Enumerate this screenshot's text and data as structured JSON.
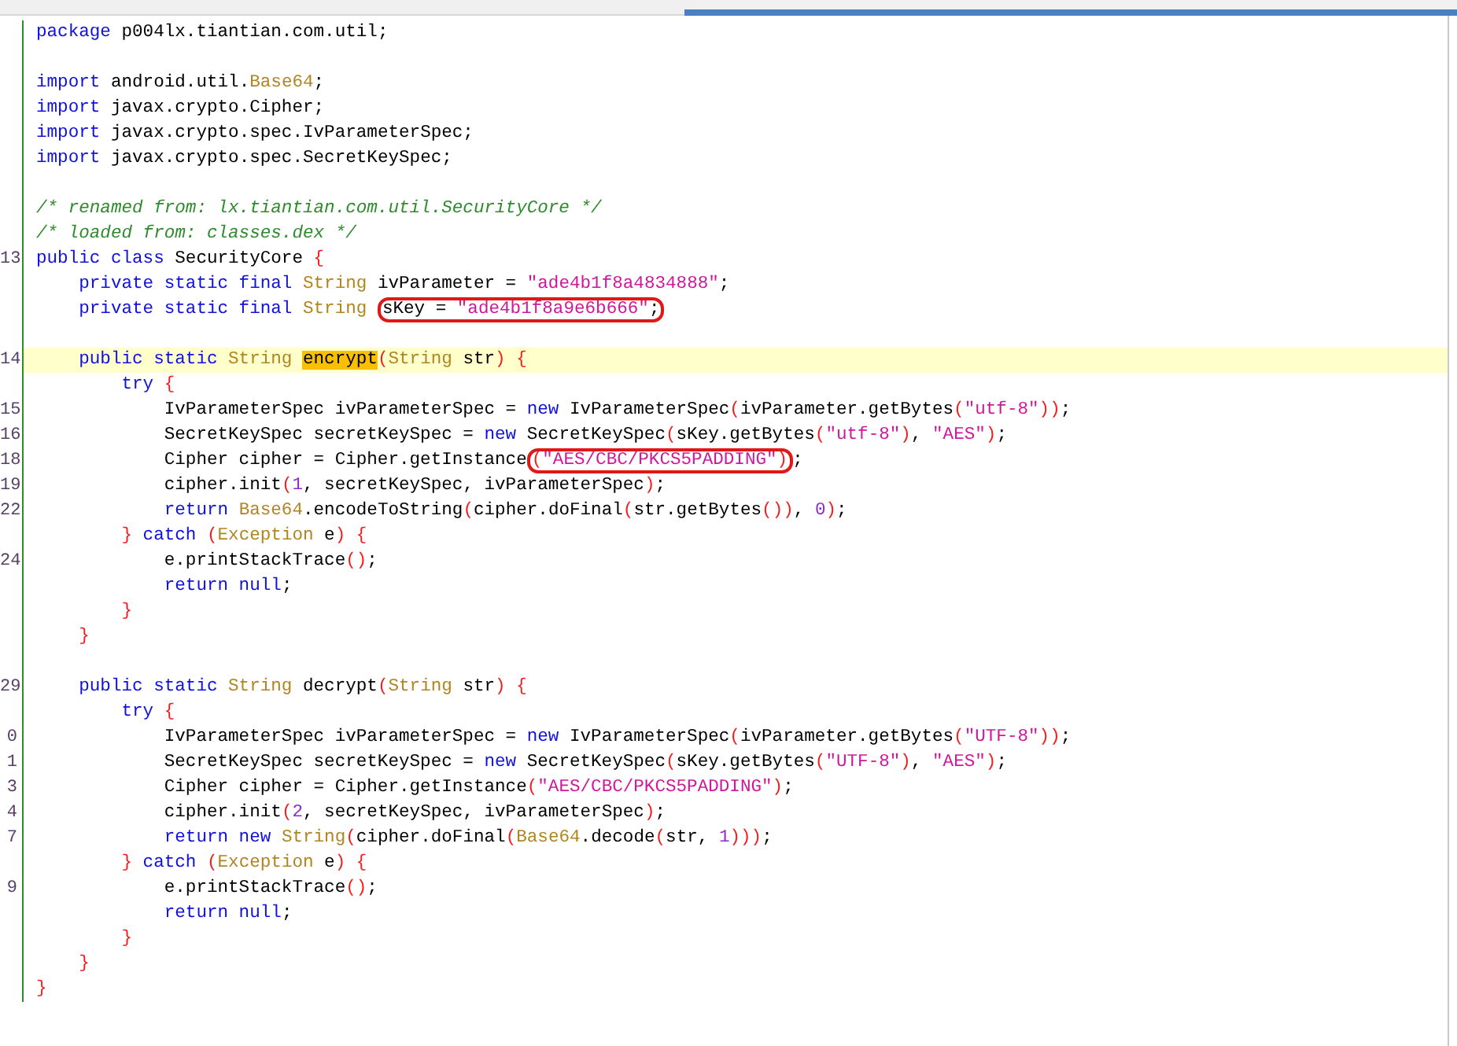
{
  "editor": {
    "lines": [
      {
        "current": false,
        "tokens": [
          {
            "kind": "keyword",
            "text": "package"
          },
          {
            "kind": "plain",
            "text": " p004lx.tiantian.com.util;"
          }
        ]
      },
      {
        "current": false
      },
      {
        "current": false,
        "tokens": [
          {
            "kind": "keyword",
            "text": "import"
          },
          {
            "kind": "plain",
            "text": " android.util."
          },
          {
            "kind": "type",
            "text": "Base64"
          },
          {
            "kind": "plain",
            "text": ";"
          }
        ]
      },
      {
        "current": false,
        "tokens": [
          {
            "kind": "keyword",
            "text": "import"
          },
          {
            "kind": "plain",
            "text": " javax.crypto.Cipher;"
          }
        ]
      },
      {
        "current": false,
        "tokens": [
          {
            "kind": "keyword",
            "text": "import"
          },
          {
            "kind": "plain",
            "text": " javax.crypto.spec.IvParameterSpec;"
          }
        ]
      },
      {
        "current": false,
        "tokens": [
          {
            "kind": "keyword",
            "text": "import"
          },
          {
            "kind": "plain",
            "text": " javax.crypto.spec.SecretKeySpec;"
          }
        ]
      },
      {
        "current": false
      },
      {
        "current": false,
        "tokens": [
          {
            "kind": "comment",
            "text": "/* renamed from: lx.tiantian.com.util.SecurityCore */"
          }
        ]
      },
      {
        "current": false,
        "tokens": [
          {
            "kind": "comment",
            "text": "/* loaded from: classes.dex */"
          }
        ]
      },
      {
        "number": "13",
        "current": false,
        "tokens": [
          {
            "kind": "keyword",
            "text": "public class"
          },
          {
            "kind": "plain",
            "text": " SecurityCore "
          },
          {
            "kind": "brace",
            "text": "{"
          }
        ]
      },
      {
        "current": false,
        "tokens": [
          {
            "kind": "keyword",
            "text": "    private static final"
          },
          {
            "kind": "type",
            "text": " String"
          },
          {
            "kind": "plain",
            "text": " ivParameter = "
          },
          {
            "kind": "string",
            "text": "\"ade4b1f8a4834888\""
          },
          {
            "kind": "plain",
            "text": ";"
          }
        ]
      },
      {
        "current": false,
        "tokens": [
          {
            "kind": "keyword",
            "text": "    private static final"
          },
          {
            "kind": "type",
            "text": " String "
          },
          {
            "kind": "ring",
            "tokens": [
              {
                "kind": "plain",
                "text": "sKey = "
              },
              {
                "kind": "string",
                "text": "\"ade4b1f8a9e6b666\""
              },
              {
                "kind": "plain",
                "text": ";"
              }
            ]
          }
        ]
      },
      {
        "current": false
      },
      {
        "number": "14",
        "current": true,
        "tokens": [
          {
            "kind": "keyword",
            "text": "    public static"
          },
          {
            "kind": "type",
            "text": " String "
          },
          {
            "kind": "match",
            "text": "encrypt"
          },
          {
            "kind": "brace",
            "text": "("
          },
          {
            "kind": "type",
            "text": "String"
          },
          {
            "kind": "plain",
            "text": " str"
          },
          {
            "kind": "brace",
            "text": ") {"
          }
        ]
      },
      {
        "current": false,
        "tokens": [
          {
            "kind": "keyword",
            "text": "        try "
          },
          {
            "kind": "brace",
            "text": "{"
          }
        ]
      },
      {
        "number": "15",
        "current": false,
        "tokens": [
          {
            "kind": "plain",
            "text": "            IvParameterSpec ivParameterSpec = "
          },
          {
            "kind": "keyword",
            "text": "new"
          },
          {
            "kind": "plain",
            "text": " IvParameterSpec"
          },
          {
            "kind": "brace",
            "text": "("
          },
          {
            "kind": "plain",
            "text": "ivParameter.getBytes"
          },
          {
            "kind": "brace",
            "text": "("
          },
          {
            "kind": "string",
            "text": "\"utf-8\""
          },
          {
            "kind": "brace",
            "text": "))"
          },
          {
            "kind": "plain",
            "text": ";"
          }
        ]
      },
      {
        "number": "16",
        "current": false,
        "tokens": [
          {
            "kind": "plain",
            "text": "            SecretKeySpec secretKeySpec = "
          },
          {
            "kind": "keyword",
            "text": "new"
          },
          {
            "kind": "plain",
            "text": " SecretKeySpec"
          },
          {
            "kind": "brace",
            "text": "("
          },
          {
            "kind": "plain",
            "text": "sKey.getBytes"
          },
          {
            "kind": "brace",
            "text": "("
          },
          {
            "kind": "string",
            "text": "\"utf-8\""
          },
          {
            "kind": "brace",
            "text": ")"
          },
          {
            "kind": "plain",
            "text": ", "
          },
          {
            "kind": "string",
            "text": "\"AES\""
          },
          {
            "kind": "brace",
            "text": ")"
          },
          {
            "kind": "plain",
            "text": ";"
          }
        ]
      },
      {
        "number": "18",
        "current": false,
        "tokens": [
          {
            "kind": "plain",
            "text": "            Cipher cipher = Cipher.getInstance"
          },
          {
            "kind": "ring",
            "tokens": [
              {
                "kind": "brace",
                "text": "("
              },
              {
                "kind": "string",
                "text": "\"AES/CBC/PKCS5PADDING\""
              },
              {
                "kind": "brace",
                "text": ")"
              }
            ]
          },
          {
            "kind": "plain",
            "text": ";"
          }
        ]
      },
      {
        "number": "19",
        "current": false,
        "tokens": [
          {
            "kind": "plain",
            "text": "            cipher.init"
          },
          {
            "kind": "brace",
            "text": "("
          },
          {
            "kind": "number",
            "text": "1"
          },
          {
            "kind": "plain",
            "text": ", secretKeySpec, ivParameterSpec"
          },
          {
            "kind": "brace",
            "text": ")"
          },
          {
            "kind": "plain",
            "text": ";"
          }
        ]
      },
      {
        "number": "22",
        "current": false,
        "tokens": [
          {
            "kind": "keyword",
            "text": "            return "
          },
          {
            "kind": "type",
            "text": "Base64"
          },
          {
            "kind": "plain",
            "text": ".encodeToString"
          },
          {
            "kind": "brace",
            "text": "("
          },
          {
            "kind": "plain",
            "text": "cipher.doFinal"
          },
          {
            "kind": "brace",
            "text": "("
          },
          {
            "kind": "plain",
            "text": "str.getBytes"
          },
          {
            "kind": "brace",
            "text": "())"
          },
          {
            "kind": "plain",
            "text": ", "
          },
          {
            "kind": "number",
            "text": "0"
          },
          {
            "kind": "brace",
            "text": ")"
          },
          {
            "kind": "plain",
            "text": ";"
          }
        ]
      },
      {
        "current": false,
        "tokens": [
          {
            "kind": "brace",
            "text": "        } "
          },
          {
            "kind": "keyword",
            "text": "catch "
          },
          {
            "kind": "brace",
            "text": "("
          },
          {
            "kind": "type",
            "text": "Exception"
          },
          {
            "kind": "plain",
            "text": " e"
          },
          {
            "kind": "brace",
            "text": ") {"
          }
        ]
      },
      {
        "number": "24",
        "current": false,
        "tokens": [
          {
            "kind": "plain",
            "text": "            e.printStackTrace"
          },
          {
            "kind": "brace",
            "text": "()"
          },
          {
            "kind": "plain",
            "text": ";"
          }
        ]
      },
      {
        "current": false,
        "tokens": [
          {
            "kind": "keyword",
            "text": "            return null"
          },
          {
            "kind": "plain",
            "text": ";"
          }
        ]
      },
      {
        "current": false,
        "tokens": [
          {
            "kind": "brace",
            "text": "        }"
          }
        ]
      },
      {
        "current": false,
        "tokens": [
          {
            "kind": "brace",
            "text": "    }"
          }
        ]
      },
      {
        "current": false
      },
      {
        "number": "29",
        "current": false,
        "tokens": [
          {
            "kind": "keyword",
            "text": "    public static"
          },
          {
            "kind": "type",
            "text": " String"
          },
          {
            "kind": "plain",
            "text": " decrypt"
          },
          {
            "kind": "brace",
            "text": "("
          },
          {
            "kind": "type",
            "text": "String"
          },
          {
            "kind": "plain",
            "text": " str"
          },
          {
            "kind": "brace",
            "text": ") {"
          }
        ]
      },
      {
        "current": false,
        "tokens": [
          {
            "kind": "keyword",
            "text": "        try "
          },
          {
            "kind": "brace",
            "text": "{"
          }
        ]
      },
      {
        "number": "0",
        "current": false,
        "tokens": [
          {
            "kind": "plain",
            "text": "            IvParameterSpec ivParameterSpec = "
          },
          {
            "kind": "keyword",
            "text": "new"
          },
          {
            "kind": "plain",
            "text": " IvParameterSpec"
          },
          {
            "kind": "brace",
            "text": "("
          },
          {
            "kind": "plain",
            "text": "ivParameter.getBytes"
          },
          {
            "kind": "brace",
            "text": "("
          },
          {
            "kind": "string",
            "text": "\"UTF-8\""
          },
          {
            "kind": "brace",
            "text": "))"
          },
          {
            "kind": "plain",
            "text": ";"
          }
        ]
      },
      {
        "number": "1",
        "current": false,
        "tokens": [
          {
            "kind": "plain",
            "text": "            SecretKeySpec secretKeySpec = "
          },
          {
            "kind": "keyword",
            "text": "new"
          },
          {
            "kind": "plain",
            "text": " SecretKeySpec"
          },
          {
            "kind": "brace",
            "text": "("
          },
          {
            "kind": "plain",
            "text": "sKey.getBytes"
          },
          {
            "kind": "brace",
            "text": "("
          },
          {
            "kind": "string",
            "text": "\"UTF-8\""
          },
          {
            "kind": "brace",
            "text": ")"
          },
          {
            "kind": "plain",
            "text": ", "
          },
          {
            "kind": "string",
            "text": "\"AES\""
          },
          {
            "kind": "brace",
            "text": ")"
          },
          {
            "kind": "plain",
            "text": ";"
          }
        ]
      },
      {
        "number": "3",
        "current": false,
        "tokens": [
          {
            "kind": "plain",
            "text": "            Cipher cipher = Cipher.getInstance"
          },
          {
            "kind": "brace",
            "text": "("
          },
          {
            "kind": "string",
            "text": "\"AES/CBC/PKCS5PADDING\""
          },
          {
            "kind": "brace",
            "text": ")"
          },
          {
            "kind": "plain",
            "text": ";"
          }
        ]
      },
      {
        "number": "4",
        "current": false,
        "tokens": [
          {
            "kind": "plain",
            "text": "            cipher.init"
          },
          {
            "kind": "brace",
            "text": "("
          },
          {
            "kind": "number",
            "text": "2"
          },
          {
            "kind": "plain",
            "text": ", secretKeySpec, ivParameterSpec"
          },
          {
            "kind": "brace",
            "text": ")"
          },
          {
            "kind": "plain",
            "text": ";"
          }
        ]
      },
      {
        "number": "7",
        "current": false,
        "tokens": [
          {
            "kind": "keyword",
            "text": "            return new "
          },
          {
            "kind": "type",
            "text": "String"
          },
          {
            "kind": "brace",
            "text": "("
          },
          {
            "kind": "plain",
            "text": "cipher.doFinal"
          },
          {
            "kind": "brace",
            "text": "("
          },
          {
            "kind": "type",
            "text": "Base64"
          },
          {
            "kind": "plain",
            "text": ".decode"
          },
          {
            "kind": "brace",
            "text": "("
          },
          {
            "kind": "plain",
            "text": "str, "
          },
          {
            "kind": "number",
            "text": "1"
          },
          {
            "kind": "brace",
            "text": ")))"
          },
          {
            "kind": "plain",
            "text": ";"
          }
        ]
      },
      {
        "current": false,
        "tokens": [
          {
            "kind": "brace",
            "text": "        } "
          },
          {
            "kind": "keyword",
            "text": "catch "
          },
          {
            "kind": "brace",
            "text": "("
          },
          {
            "kind": "type",
            "text": "Exception"
          },
          {
            "kind": "plain",
            "text": " e"
          },
          {
            "kind": "brace",
            "text": ") {"
          }
        ]
      },
      {
        "number": "9",
        "current": false,
        "tokens": [
          {
            "kind": "plain",
            "text": "            e.printStackTrace"
          },
          {
            "kind": "brace",
            "text": "()"
          },
          {
            "kind": "plain",
            "text": ";"
          }
        ]
      },
      {
        "current": false,
        "tokens": [
          {
            "kind": "keyword",
            "text": "            return null"
          },
          {
            "kind": "plain",
            "text": ";"
          }
        ]
      },
      {
        "current": false,
        "tokens": [
          {
            "kind": "brace",
            "text": "        }"
          }
        ]
      },
      {
        "current": false,
        "tokens": [
          {
            "kind": "brace",
            "text": "    }"
          }
        ]
      },
      {
        "current": false,
        "tokens": [
          {
            "kind": "brace",
            "text": "}"
          }
        ]
      }
    ]
  }
}
